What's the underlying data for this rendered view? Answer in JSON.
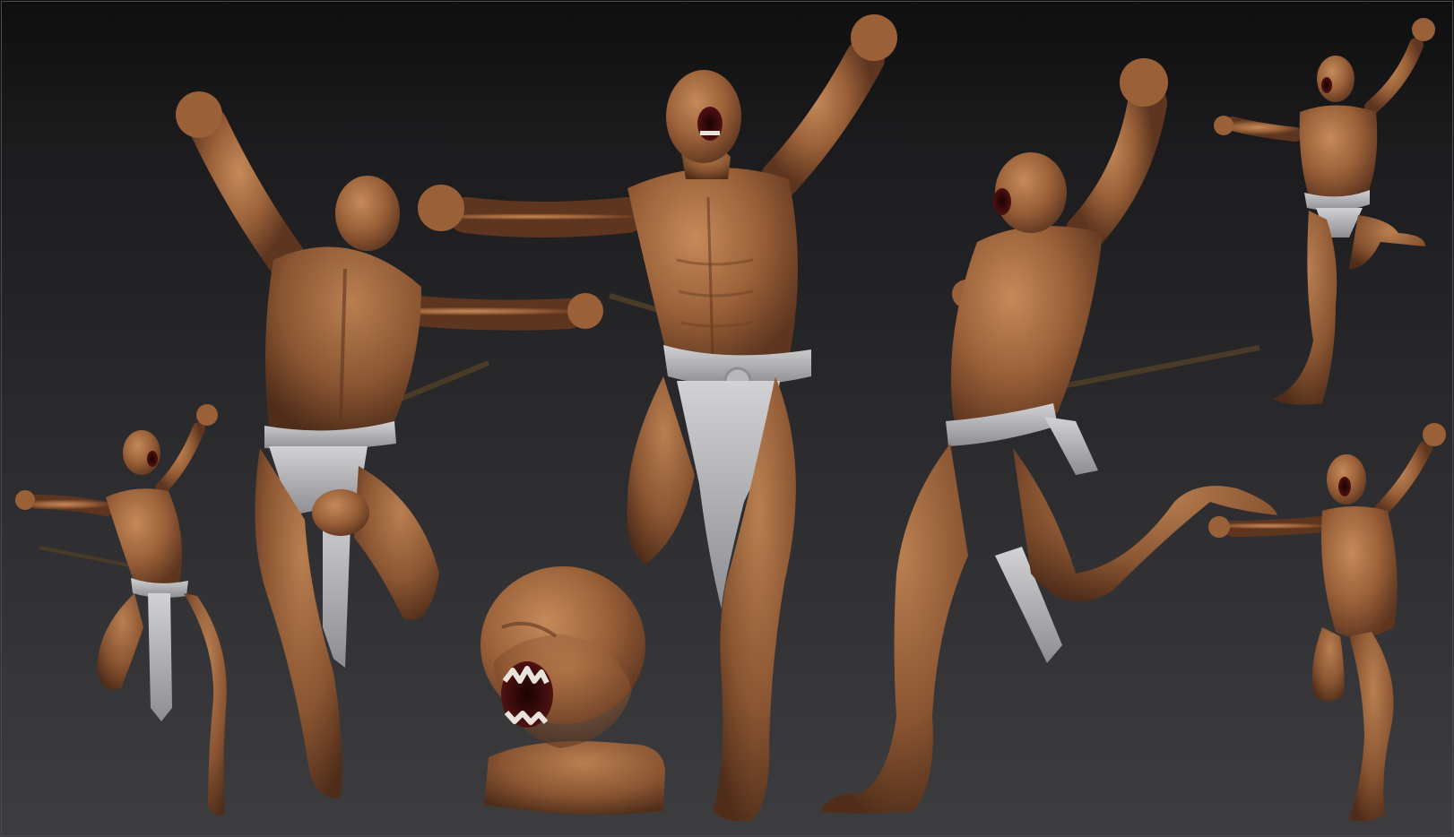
{
  "scene": {
    "description_visible_text": "",
    "background_top": "#0f0f10",
    "background_bottom": "#3d3d40",
    "skin_light": "#b17a4e",
    "skin_mid": "#8f5a35",
    "skin_dark": "#5a3520",
    "cloth_light": "#c9c9cc",
    "cloth_dark": "#8c8c90",
    "spear_color": "#4a3a28",
    "mouth_color": "#3a0c0c",
    "teeth_color": "#e8e4dc"
  },
  "figures": [
    {
      "id": "small-front-left",
      "pose": "front-leaping"
    },
    {
      "id": "back-view",
      "pose": "back-leaping"
    },
    {
      "id": "center-front",
      "pose": "front-running-screaming"
    },
    {
      "id": "side-view",
      "pose": "side-kick"
    },
    {
      "id": "small-top-right",
      "pose": "front-raised-fist"
    },
    {
      "id": "small-bottom-right",
      "pose": "front-running"
    },
    {
      "id": "head-bust",
      "pose": "screaming-head"
    }
  ]
}
